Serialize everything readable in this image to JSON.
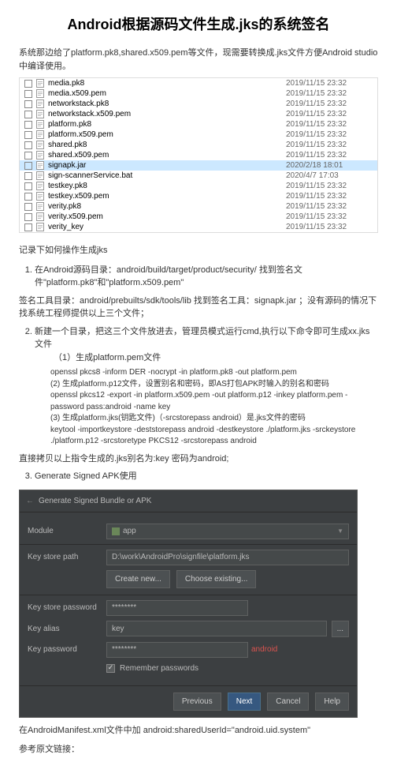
{
  "title": "Android根据源码文件生成.jks的系统签名",
  "intro": "系统那边给了platform.pk8,shared.x509.pem等文件，现需要转换成.jks文件方便Android studio中编译使用。",
  "files": [
    {
      "name": "media.pk8",
      "date": "2019/11/15 23:32",
      "type": "file"
    },
    {
      "name": "media.x509.pem",
      "date": "2019/11/15 23:32",
      "type": "file"
    },
    {
      "name": "networkstack.pk8",
      "date": "2019/11/15 23:32",
      "type": "file"
    },
    {
      "name": "networkstack.x509.pem",
      "date": "2019/11/15 23:32",
      "type": "file"
    },
    {
      "name": "platform.pk8",
      "date": "2019/11/15 23:32",
      "type": "file"
    },
    {
      "name": "platform.x509.pem",
      "date": "2019/11/15 23:32",
      "type": "file"
    },
    {
      "name": "shared.pk8",
      "date": "2019/11/15 23:32",
      "type": "file"
    },
    {
      "name": "shared.x509.pem",
      "date": "2019/11/15 23:32",
      "type": "file"
    },
    {
      "name": "signapk.jar",
      "date": "2020/2/18 18:01",
      "type": "jar",
      "selected": true
    },
    {
      "name": "sign-scannerService.bat",
      "date": "2020/4/7 17:03",
      "type": "bat"
    },
    {
      "name": "testkey.pk8",
      "date": "2019/11/15 23:32",
      "type": "file"
    },
    {
      "name": "testkey.x509.pem",
      "date": "2019/11/15 23:32",
      "type": "file"
    },
    {
      "name": "verity.pk8",
      "date": "2019/11/15 23:32",
      "type": "file"
    },
    {
      "name": "verity.x509.pem",
      "date": "2019/11/15 23:32",
      "type": "file"
    },
    {
      "name": "verity_key",
      "date": "2019/11/15 23:32",
      "type": "file"
    }
  ],
  "sectionHeader": "记录下如何操作生成jks",
  "step1": "在Android源码目录：android/build/target/product/security/ 找到签名文件\"platform.pk8\"和\"platform.x509.pem\"",
  "toolLine": "签名工具目录：android/prebuilts/sdk/tools/lib 找到签名工具：signapk.jar ；没有源码的情况下找系统工程师提供以上三个文件；",
  "step2": "新建一个目录，把这三个文件放进去，管理员模式运行cmd,执行以下命令即可生成xx.jks文件",
  "step2Sub": "（1）生成platform.pem文件",
  "codeLines": [
    "openssl pkcs8 -inform DER -nocrypt -in platform.pk8 -out platform.pem",
    "(2) 生成platform.p12文件，设置别名和密码，即AS打包APK时输入的别名和密码",
    "openssl pkcs12 -export -in platform.x509.pem -out platform.p12 -inkey platform.pem -password pass:android -name key",
    "(3) 生成platform.jks(钥匙文件)（-srcstorepass android）是.jks文件的密码",
    "keytool -importkeystore -deststorepass android -destkeystore ./platform.jks -srckeystore ./platform.p12 -srcstoretype PKCS12 -srcstorepass android"
  ],
  "afterCode": "直接拷贝以上指令生成的.jks别名为:key 密码为android;",
  "step3": "Generate Signed APK使用",
  "dialog": {
    "breadcrumb": "Generate Signed Bundle or APK",
    "moduleLabel": "Module",
    "moduleValue": "app",
    "keystorePathLabel": "Key store path",
    "keystorePathValue": "D:\\work\\AndroidPro\\signfile\\platform.jks",
    "createBtn": "Create new...",
    "chooseBtn": "Choose existing...",
    "keystorePassLabel": "Key store password",
    "keystorePassValue": "********",
    "keyAliasLabel": "Key alias",
    "keyAliasValue": "key",
    "keyPassLabel": "Key password",
    "keyPassValue": "********",
    "redHint": "android",
    "rememberLabel": "Remember passwords",
    "buttons": {
      "previous": "Previous",
      "next": "Next",
      "cancel": "Cancel",
      "help": "Help"
    }
  },
  "manifestLine": "在AndroidManifest.xml文件中加 android:sharedUserId=\"android.uid.system\"",
  "refLine": "参考原文链接："
}
